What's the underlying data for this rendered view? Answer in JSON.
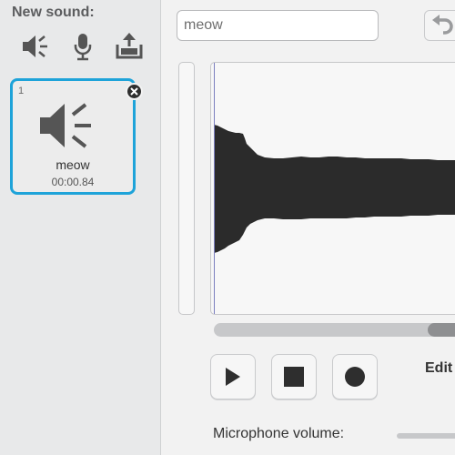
{
  "library": {
    "title": "New sound:",
    "tools": [
      {
        "name": "choose-sound-from-library",
        "icon": "speaker-icon"
      },
      {
        "name": "record-new-sound",
        "icon": "microphone-icon"
      },
      {
        "name": "upload-sound",
        "icon": "upload-icon"
      }
    ],
    "sounds": [
      {
        "index": "1",
        "name": "meow",
        "duration": "00:00.84",
        "selected": true
      }
    ]
  },
  "editor": {
    "sound_name": "meow",
    "edit_label": "Edit",
    "microphone_volume_label": "Microphone volume:"
  },
  "colors": {
    "selection_border": "#1ea3d9",
    "waveform": "#2b2b2b",
    "playhead": "#7c7fbf"
  }
}
